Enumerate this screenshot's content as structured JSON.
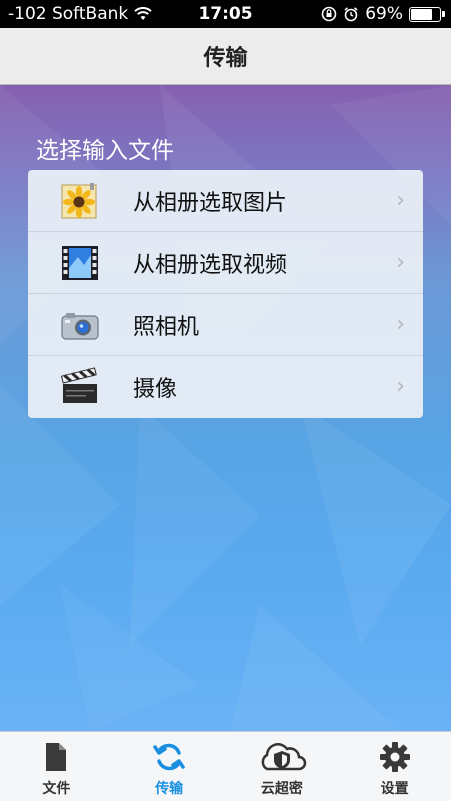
{
  "status_bar": {
    "carrier": "-102 SoftBank",
    "time": "17:05",
    "battery": "69%",
    "battery_level": 0.69
  },
  "navbar": {
    "title": "传输"
  },
  "section": {
    "title": "选择输入文件"
  },
  "items": [
    {
      "label": "从相册选取图片",
      "icon": "sunflower-photo-icon"
    },
    {
      "label": "从相册选取视频",
      "icon": "film-video-icon"
    },
    {
      "label": "照相机",
      "icon": "camera-icon"
    },
    {
      "label": "摄像",
      "icon": "clapperboard-icon"
    }
  ],
  "tabs": [
    {
      "label": "文件",
      "icon": "file-icon",
      "active": false
    },
    {
      "label": "传输",
      "icon": "sync-icon",
      "active": true
    },
    {
      "label": "云超密",
      "icon": "cloud-shield-icon",
      "active": false
    },
    {
      "label": "设置",
      "icon": "gear-icon",
      "active": false
    }
  ],
  "colors": {
    "accent": "#1a8fe0"
  }
}
